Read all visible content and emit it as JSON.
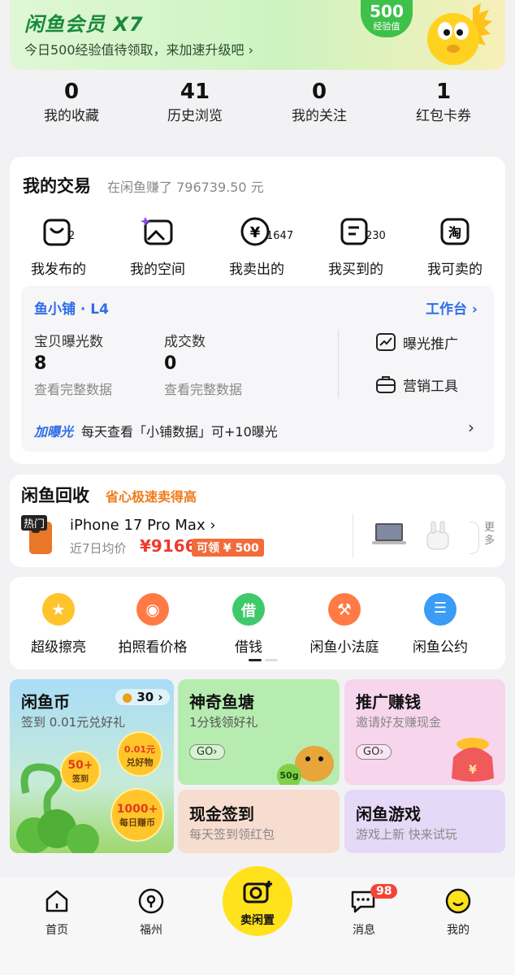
{
  "member": {
    "title": "闲鱼会员 X7",
    "subtitle": "今日500经验值待领取，来加速升级吧 ›",
    "exp_value": "500",
    "exp_label": "经验值"
  },
  "stats": [
    {
      "num": "0",
      "label": "我的收藏"
    },
    {
      "num": "41",
      "label": "历史浏览"
    },
    {
      "num": "0",
      "label": "我的关注"
    },
    {
      "num": "1",
      "label": "红包卡券"
    }
  ],
  "trade": {
    "title": "我的交易",
    "earned": "在闲鱼赚了 796739.50 元",
    "items": [
      {
        "label": "我发布的",
        "count": "2",
        "icon": "bag-icon"
      },
      {
        "label": "我的空间",
        "count": "",
        "icon": "image-icon"
      },
      {
        "label": "我卖出的",
        "count": "1647",
        "icon": "yen-icon"
      },
      {
        "label": "我买到的",
        "count": "230",
        "icon": "receipt-icon"
      },
      {
        "label": "我可卖的",
        "count": "",
        "icon": "tao-icon"
      }
    ]
  },
  "shop": {
    "name": "鱼小铺 · L4",
    "workbench": "工作台 ›",
    "metrics": [
      {
        "label": "宝贝曝光数",
        "value": "8",
        "link": "查看完整数据"
      },
      {
        "label": "成交数",
        "value": "0",
        "link": "查看完整数据"
      }
    ],
    "tools": [
      "曝光推广",
      "营销工具"
    ],
    "boost_tag": "加曝光",
    "boost_text": "每天查看「小铺数据」可+10曝光",
    "boost_arrow": "›"
  },
  "recycle": {
    "title": "闲鱼回收",
    "subtitle": "省心极速卖得高",
    "hot_tag": "热门",
    "product": "iPhone 17 Pro Max ›",
    "avg_label": "近7日均价",
    "price": "¥9166",
    "coupon": "可领 ¥ 500",
    "more": "更多"
  },
  "tools": [
    {
      "label": "超级擦亮",
      "color": "#ffc42b",
      "icon": "sparkle-star-icon",
      "glyph": "★"
    },
    {
      "label": "拍照看价格",
      "color": "#ff7a45",
      "icon": "camera-icon",
      "glyph": "◉"
    },
    {
      "label": "借钱",
      "color": "#3ec96a",
      "icon": "borrow-icon",
      "glyph": "借"
    },
    {
      "label": "闲鱼小法庭",
      "color": "#ff7a45",
      "icon": "gavel-icon",
      "glyph": "⚒"
    },
    {
      "label": "闲鱼公约",
      "color": "#3a9cf5",
      "icon": "pact-bag-icon",
      "glyph": "☰"
    }
  ],
  "grid": {
    "coin": {
      "title": "闲鱼币",
      "sub": "签到 0.01元兑好礼",
      "coin_count": "30 ›",
      "badge1_a": "0.01元",
      "badge1_b": "兑好物",
      "badge2_a": "50+",
      "badge2_b": "签到",
      "badge3_a": "1000+",
      "badge3_b": "每日赚币"
    },
    "pond": {
      "title": "神奇鱼塘",
      "sub": "1分钱领好礼",
      "go": "GO›",
      "gram": "50g"
    },
    "promo": {
      "title": "推广赚钱",
      "sub": "邀请好友赚现金",
      "go": "GO›"
    },
    "cash": {
      "title": "现金签到",
      "sub": "每天签到领红包"
    },
    "game": {
      "title": "闲鱼游戏",
      "sub": "游戏上新 快来试玩"
    }
  },
  "nav": {
    "home": "首页",
    "city": "福州",
    "sell": "卖闲置",
    "messages": "消息",
    "messages_badge": "98",
    "me": "我的"
  },
  "colors": {
    "accent_blue": "#2f6de6",
    "price_red": "#ee3a2b",
    "brand_yellow": "#ffe21c",
    "member_green": "#1a8a3a"
  }
}
